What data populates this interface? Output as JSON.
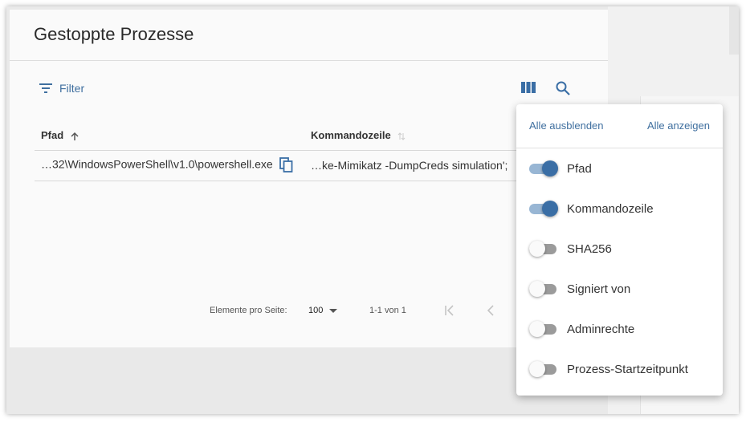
{
  "card": {
    "title": "Gestoppte Prozesse"
  },
  "toolbar": {
    "filter_label": "Filter",
    "columns_icon": "view-columns-icon",
    "search_icon": "search-icon"
  },
  "table": {
    "headers": [
      {
        "label": "Pfad",
        "sort": "ascending"
      },
      {
        "label": "Kommandozeile",
        "sort": "none"
      }
    ],
    "rows": [
      {
        "pfad": "…32\\WindowsPowerShell\\v1.0\\powershell.exe",
        "kommandozeile": "…ke-Mimikatz -DumpCreds simulation';"
      }
    ]
  },
  "paginator": {
    "items_per_page_label": "Elemente pro Seite:",
    "page_size": "100",
    "range": "1-1 von 1"
  },
  "column_menu": {
    "hide_all": "Alle ausblenden",
    "show_all": "Alle anzeigen",
    "columns": [
      {
        "label": "Pfad",
        "enabled": true
      },
      {
        "label": "Kommandozeile",
        "enabled": true
      },
      {
        "label": "SHA256",
        "enabled": false
      },
      {
        "label": "Signiert von",
        "enabled": false
      },
      {
        "label": "Adminrechte",
        "enabled": false
      },
      {
        "label": "Prozess-Startzeitpunkt",
        "enabled": false
      }
    ]
  },
  "colors": {
    "accent": "#3a6ea5",
    "link": "#3f6f9f",
    "track_on": "#98b6d4",
    "track_off": "#9b9b9b"
  }
}
